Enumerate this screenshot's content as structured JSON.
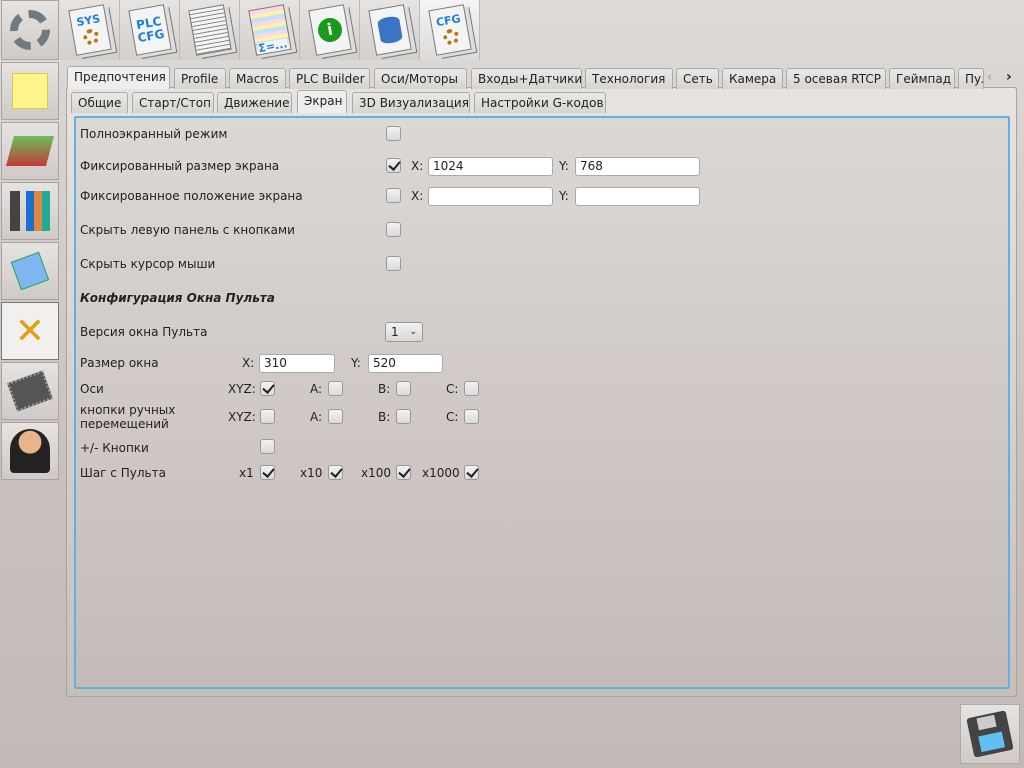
{
  "toolbar": {
    "items": [
      {
        "name": "sys",
        "text": "SYS"
      },
      {
        "name": "plc-cfg",
        "text": "PLC CFG"
      },
      {
        "name": "document",
        "text": ""
      },
      {
        "name": "sum",
        "text": "Σ=..."
      },
      {
        "name": "info",
        "text": "i"
      },
      {
        "name": "database",
        "text": ""
      },
      {
        "name": "cfg",
        "text": "CFG"
      }
    ]
  },
  "sidebar": {
    "items": [
      "settings",
      "notes",
      "books",
      "tools-chart",
      "mycnc",
      "configuration",
      "chip",
      "user"
    ]
  },
  "main_tabs": [
    "Предпочтения",
    "Profile",
    "Macros",
    "PLC Builder",
    "Оси/Моторы",
    "Входы+Датчики",
    "Технология",
    "Сеть",
    "Камера",
    "5 осевая RTCP",
    "Геймпад",
    "Пул"
  ],
  "sub_tabs": [
    "Общие",
    "Старт/Стоп",
    "Движение",
    "Экран",
    "3D Визуализация",
    "Настройки G-кодов"
  ],
  "screen": {
    "fullscreen": {
      "label": "Полноэкранный режим",
      "checked": false
    },
    "fixed_size": {
      "label": "Фиксированный размер экрана",
      "checked": true,
      "x_label": "X:",
      "x": "1024",
      "y_label": "Y:",
      "y": "768"
    },
    "fixed_pos": {
      "label": "Фиксированное положение экрана",
      "checked": false,
      "x_label": "X:",
      "x": "",
      "y_label": "Y:",
      "y": ""
    },
    "hide_panel": {
      "label": "Скрыть левую панель с кнопками",
      "checked": false
    },
    "hide_cursor": {
      "label": "Скрыть курсор мыши",
      "checked": false
    }
  },
  "pendant": {
    "title": "Конфигурация Окна Пульта",
    "version_label": "Версия окна Пульта",
    "version": "1",
    "size_label": "Размер окна",
    "x_label": "X:",
    "x": "310",
    "y_label": "Y:",
    "y": "520",
    "axes_label": "Оси",
    "axes": [
      {
        "label": "XYZ:",
        "checked": true
      },
      {
        "label": "A:",
        "checked": false
      },
      {
        "label": "B:",
        "checked": false
      },
      {
        "label": "C:",
        "checked": false
      }
    ],
    "jog_label": "кнопки ручных перемещений",
    "jog": [
      {
        "label": "XYZ:",
        "checked": false
      },
      {
        "label": "A:",
        "checked": false
      },
      {
        "label": "B:",
        "checked": false
      },
      {
        "label": "C:",
        "checked": false
      }
    ],
    "pm_label": "+/- Кнопки",
    "pm_checked": false,
    "step_label": "Шаг с Пульта",
    "steps": [
      {
        "label": "x1",
        "checked": true
      },
      {
        "label": "x10",
        "checked": true
      },
      {
        "label": "x100",
        "checked": true
      },
      {
        "label": "x1000",
        "checked": true
      }
    ]
  },
  "accent": "#5fb2e0"
}
